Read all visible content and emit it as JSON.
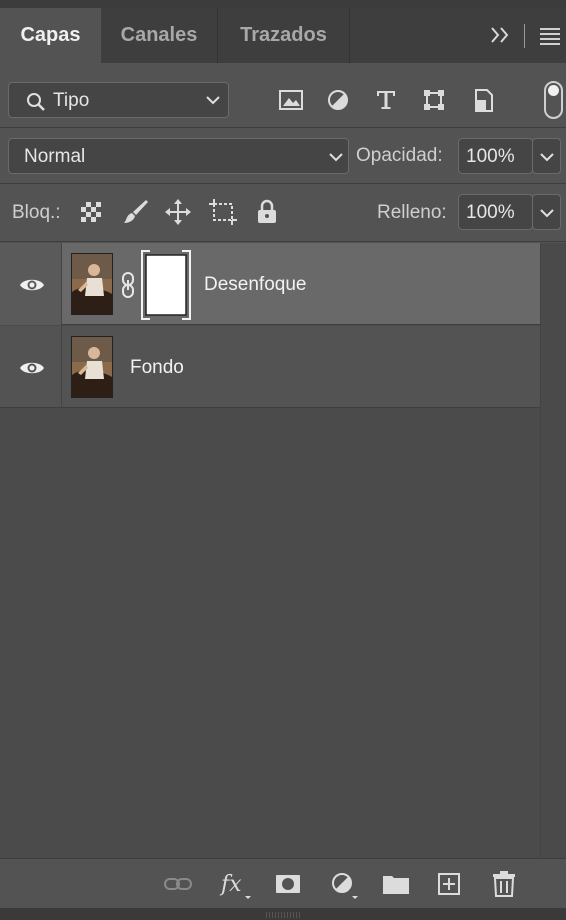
{
  "tabs": [
    {
      "label": "Capas",
      "active": true
    },
    {
      "label": "Canales",
      "active": false
    },
    {
      "label": "Trazados",
      "active": false
    }
  ],
  "filter": {
    "kind_label": "Tipo"
  },
  "blend": {
    "mode": "Normal",
    "opacity_label": "Opacidad:",
    "opacity_value": "100%"
  },
  "lock": {
    "label": "Bloq.:",
    "fill_label": "Relleno:",
    "fill_value": "100%"
  },
  "layers": [
    {
      "name": "Desenfoque",
      "visible": true,
      "selected": true,
      "has_mask": true
    },
    {
      "name": "Fondo",
      "visible": true,
      "selected": false,
      "has_mask": false
    }
  ],
  "bottom_icons": [
    "link-icon",
    "fx-icon",
    "mask-icon",
    "adjustment-icon",
    "folder-icon",
    "new-layer-icon",
    "trash-icon"
  ],
  "colors": {
    "panel": "#535353",
    "tabbar": "#3e3e3e",
    "selected_row": "#696969"
  }
}
